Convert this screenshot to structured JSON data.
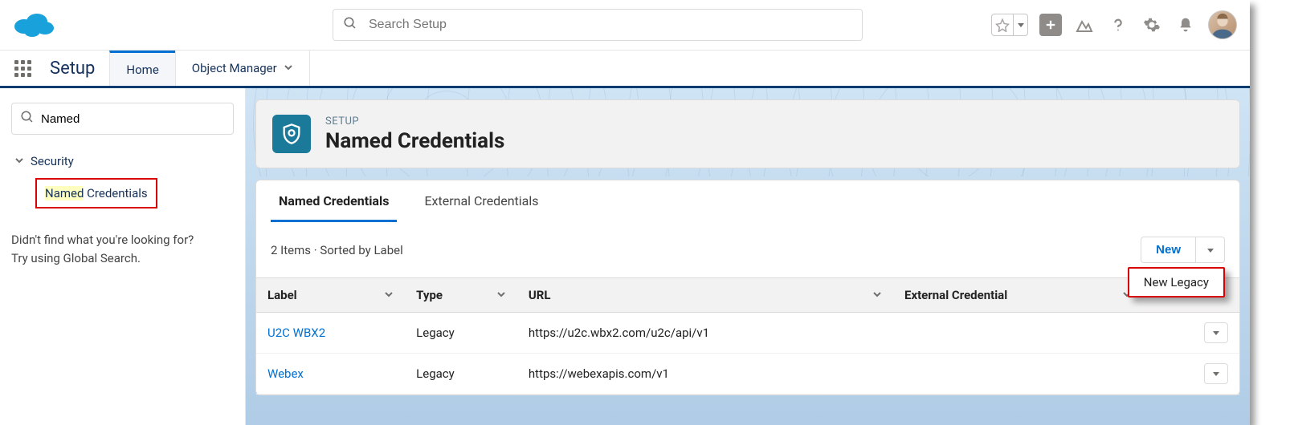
{
  "header": {
    "search_placeholder": "Search Setup"
  },
  "nav": {
    "app_title": "Setup",
    "tabs": [
      {
        "label": "Home"
      },
      {
        "label": "Object Manager"
      }
    ]
  },
  "sidebar": {
    "quick_find_value": "Named",
    "tree": {
      "section_label": "Security",
      "items": [
        {
          "highlight_label": "Named",
          "rest_label": " Credentials"
        }
      ]
    },
    "footer_line1": "Didn't find what you're looking for?",
    "footer_line2": "Try using Global Search."
  },
  "page": {
    "eyebrow": "SETUP",
    "title": "Named Credentials"
  },
  "content": {
    "tabs": [
      {
        "label": "Named Credentials"
      },
      {
        "label": "External Credentials"
      }
    ],
    "list_meta": "2 Items · Sorted by Label",
    "new_button": "New",
    "dropdown_item": "New Legacy",
    "columns": {
      "label": "Label",
      "type": "Type",
      "url": "URL",
      "ext": "External Credential"
    },
    "rows": [
      {
        "label": "U2C WBX2",
        "type": "Legacy",
        "url": "https://u2c.wbx2.com/u2c/api/v1",
        "ext": ""
      },
      {
        "label": "Webex",
        "type": "Legacy",
        "url": "https://webexapis.com/v1",
        "ext": ""
      }
    ]
  }
}
